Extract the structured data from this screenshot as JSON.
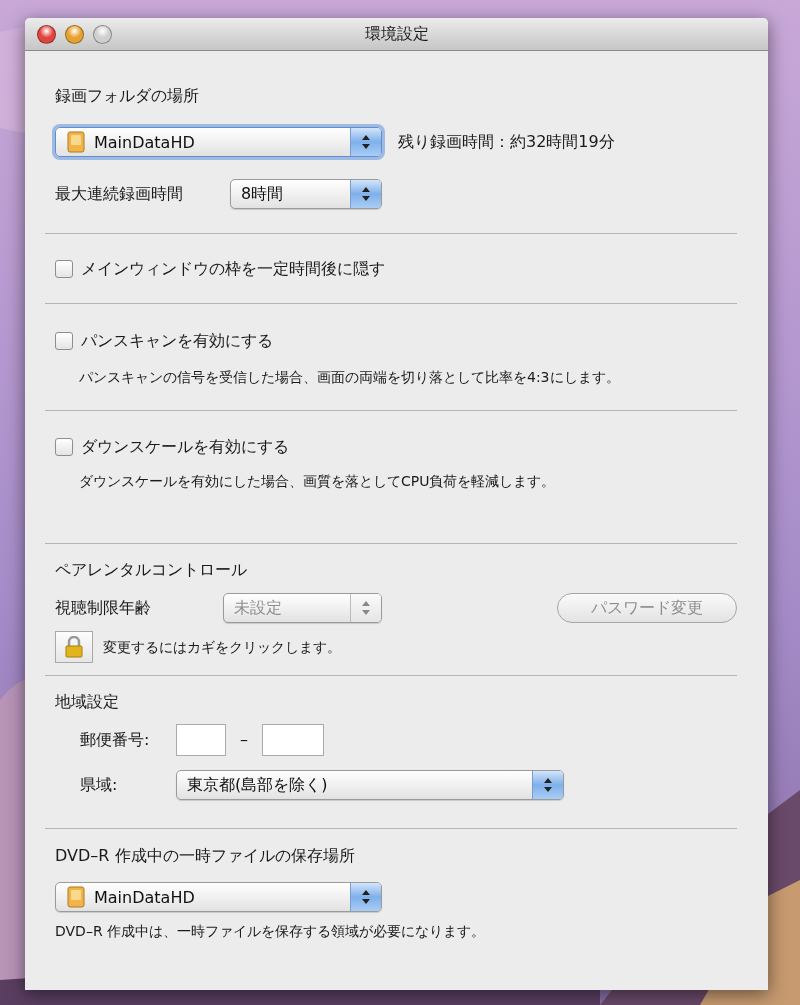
{
  "window": {
    "title": "環境設定",
    "traffic_lights": [
      {
        "color": "#e0443e"
      },
      {
        "color": "#e6a12e"
      },
      {
        "color": "#cfcfcf"
      }
    ]
  },
  "recording_folder": {
    "title": "録画フォルダの場所",
    "folder_popup": {
      "value": "MainDataHD",
      "focused": true,
      "disabled": false
    },
    "remaining": "残り録画時間：約32時間19分",
    "max_label": "最大連続録画時間",
    "max_popup": {
      "value": "8時間",
      "focused": false,
      "disabled": false
    }
  },
  "hide_frame": {
    "label": "メインウィンドウの枠を一定時間後に隠す",
    "checked": false
  },
  "pan_scan": {
    "label": "パンスキャンを有効にする",
    "checked": false,
    "description": "パンスキャンの信号を受信した場合、画面の両端を切り落として比率を4:3にします。"
  },
  "downscale": {
    "label": "ダウンスケールを有効にする",
    "checked": false,
    "description": "ダウンスケールを有効にした場合、画質を落としてCPU負荷を軽減します。"
  },
  "parental": {
    "title": "ペアレンタルコントロール",
    "age_label": "視聴制限年齢",
    "age_popup": {
      "value": "未設定",
      "focused": false,
      "disabled": true
    },
    "password_button": {
      "label": "パスワード変更",
      "disabled": true
    },
    "lock_text": "変更するにはカギをクリックします。"
  },
  "region": {
    "title": "地域設定",
    "postal_label": "郵便番号:",
    "postal_dash": "–",
    "prefecture_label": "県域:",
    "prefecture_popup": {
      "value": "東京都(島部を除く)",
      "focused": false,
      "disabled": false
    }
  },
  "dvd": {
    "title": "DVD–R 作成中の一時ファイルの保存場所",
    "popup": {
      "value": "MainDataHD",
      "focused": false,
      "disabled": false
    },
    "description": "DVD–R 作成中は、一時ファイルを保存する領域が必要になります。"
  }
}
